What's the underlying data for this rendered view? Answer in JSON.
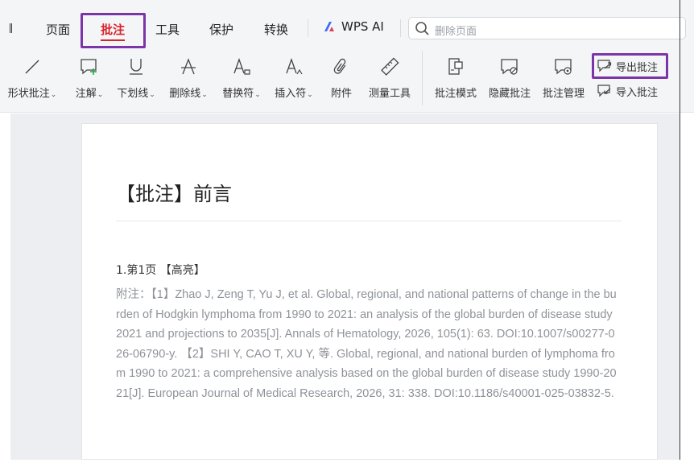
{
  "tabs": [
    {
      "label": "页面"
    },
    {
      "label": "批注"
    },
    {
      "label": "工具"
    },
    {
      "label": "保护"
    },
    {
      "label": "转换"
    }
  ],
  "tab_partial": "",
  "wps_ai": {
    "label": "WPS AI"
  },
  "search": {
    "placeholder": "删除页面"
  },
  "ribbon": {
    "tools": [
      {
        "label": "形状批注",
        "icon": "line-icon",
        "caret": true
      },
      {
        "label": "注解",
        "icon": "note-add-icon",
        "caret": true
      },
      {
        "label": "下划线",
        "icon": "underline-icon",
        "caret": true
      },
      {
        "label": "删除线",
        "icon": "strikethrough-icon",
        "caret": true
      },
      {
        "label": "替换符",
        "icon": "replace-icon",
        "caret": true
      },
      {
        "label": "插入符",
        "icon": "insert-icon",
        "caret": true
      },
      {
        "label": "附件",
        "icon": "paperclip-icon",
        "caret": false
      },
      {
        "label": "测量工具",
        "icon": "ruler-icon",
        "caret": false
      },
      {
        "label": "批注模式",
        "icon": "comment-mode-icon",
        "caret": false
      },
      {
        "label": "隐藏批注",
        "icon": "hide-comment-icon",
        "caret": false
      },
      {
        "label": "批注管理",
        "icon": "comment-manage-icon",
        "caret": false
      }
    ],
    "export_label": "导出批注",
    "import_label": "导入批注"
  },
  "document": {
    "title": "【批注】前言",
    "item_heading": "1.第1页 【高亮】",
    "attachment_text": "附注：【1】Zhao J, Zeng T, Yu J, et al. Global, regional, and national patterns of change in the burden of Hodgkin lymphoma from 1990 to 2021: an analysis of the global burden of disease study 2021 and projections to 2035[J]. Annals of Hematology, 2026, 105(1): 63. DOI:10.1007/s00277-026-06790-y. 【2】SHI Y, CAO T, XU Y, 等. Global, regional, and national burden of lymphoma from 1990 to 2021: a comprehensive analysis based on the global burden of disease study 1990-2021[J]. European Journal of Medical Research, 2026, 31: 338. DOI:10.1186/s40001-025-03832-5."
  },
  "colors": {
    "accent": "#d8232a",
    "highlight_box": "#7b35a8"
  }
}
